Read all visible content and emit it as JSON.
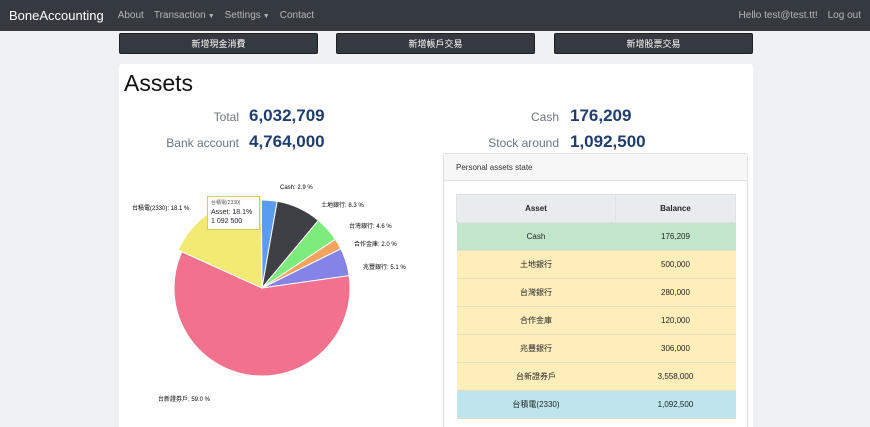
{
  "nav": {
    "brand": "BoneAccounting",
    "about": "About",
    "transaction": "Transaction",
    "settings": "Settings",
    "contact": "Contact",
    "greeting": "Hello test@test.tt!",
    "logout": "Log out"
  },
  "actions": {
    "cash_expense": "新增現金消費",
    "bank_transaction": "新增帳戶交易",
    "stock_transaction": "新增股票交易"
  },
  "assets": {
    "title": "Assets",
    "total_label": "Total",
    "total_value": "6,032,709",
    "cash_label": "Cash",
    "cash_value": "176,209",
    "bank_label": "Bank account",
    "bank_value": "4,764,000",
    "stock_label": "Stock around",
    "stock_value": "1,092,500"
  },
  "tooltip": {
    "name": "台積電(2330)",
    "line": "Asset: 18.1%",
    "value": "1 092 500"
  },
  "panel": {
    "title": "Personal assets state",
    "col_asset": "Asset",
    "col_balance": "Balance",
    "rows": [
      {
        "asset": "Cash",
        "balance": "176,209"
      },
      {
        "asset": "土地銀行",
        "balance": "500,000"
      },
      {
        "asset": "台灣銀行",
        "balance": "280,000"
      },
      {
        "asset": "合作金庫",
        "balance": "120,000"
      },
      {
        "asset": "兆豐銀行",
        "balance": "306,000"
      },
      {
        "asset": "台新證券戶",
        "balance": "3,558,000"
      },
      {
        "asset": "台積電(2330)",
        "balance": "1,092,500"
      }
    ]
  },
  "chart_data": {
    "type": "pie",
    "slices": [
      {
        "label": "Cash",
        "percent": 2.9,
        "color": "#5b9bf0",
        "text": "Cash: 2.9 %"
      },
      {
        "label": "土地銀行",
        "percent": 8.3,
        "color": "#3f4046",
        "text": "土地銀行: 8.3 %"
      },
      {
        "label": "台灣銀行",
        "percent": 4.6,
        "color": "#7ceb7c",
        "text": "台灣銀行: 4.6 %"
      },
      {
        "label": "合作金庫",
        "percent": 2.0,
        "color": "#f2a35e",
        "text": "合作金庫: 2.0 %"
      },
      {
        "label": "兆豐銀行",
        "percent": 5.1,
        "color": "#8582e8",
        "text": "兆豐銀行: 5.1 %"
      },
      {
        "label": "台新證券戶",
        "percent": 59.0,
        "color": "#f2718d",
        "text": "台新證券戶: 59.0 %"
      },
      {
        "label": "台積電(2330)",
        "percent": 18.1,
        "color": "#f2ea72",
        "text": "台積電(2330): 18.1 %"
      }
    ]
  }
}
